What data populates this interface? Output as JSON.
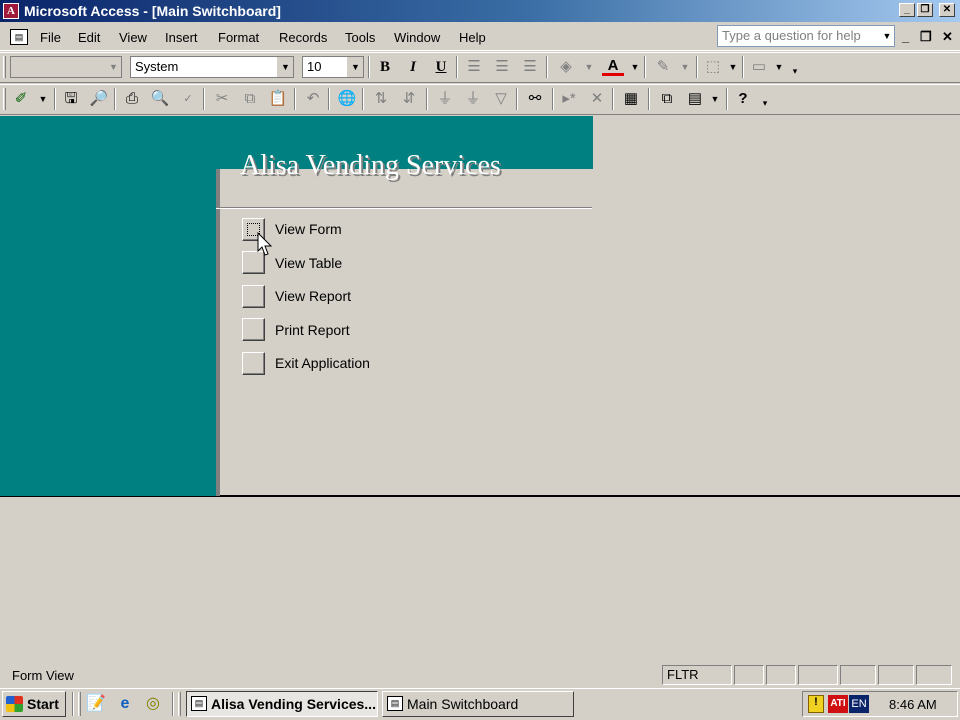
{
  "window": {
    "title": "Microsoft Access - [Main Switchboard]",
    "app_icon": "access-key-icon"
  },
  "menubar": {
    "items": [
      "File",
      "Edit",
      "View",
      "Insert",
      "Format",
      "Records",
      "Tools",
      "Window",
      "Help"
    ],
    "help_placeholder": "Type a question for help"
  },
  "toolbar": {
    "font": "System",
    "size": "10"
  },
  "switchboard": {
    "title": "Alisa Vending Services",
    "items": [
      "View Form",
      "View Table",
      "View Report",
      "Print Report",
      "Exit Application"
    ],
    "background_color": "#008080"
  },
  "statusbar": {
    "mode": "Form View",
    "indicator": "FLTR"
  },
  "taskbar": {
    "start": "Start",
    "tasks": [
      "Alisa Vending Services...",
      "Main Switchboard"
    ],
    "tray_lang": "EN",
    "clock": "8:46 AM"
  }
}
